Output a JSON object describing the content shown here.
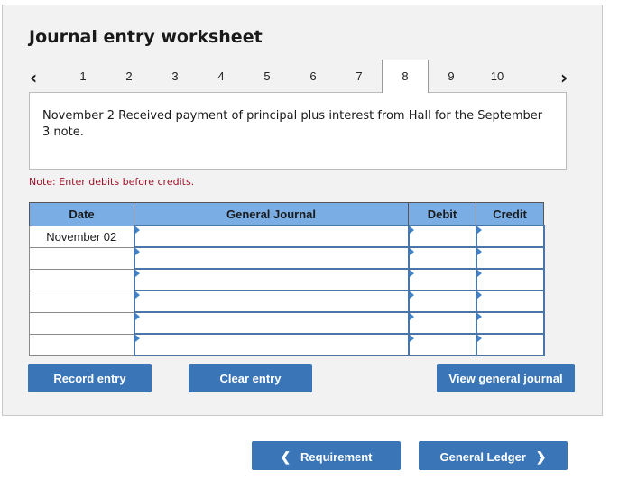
{
  "header": {
    "title": "Journal entry worksheet"
  },
  "tabs": {
    "prev_icon": "‹",
    "next_icon": "›",
    "items": [
      "1",
      "2",
      "3",
      "4",
      "5",
      "6",
      "7",
      "8",
      "9",
      "10"
    ],
    "active": "8"
  },
  "description": "November 2 Received payment of principal plus interest from Hall for the September 3 note.",
  "note": "Note: Enter debits before credits.",
  "journal": {
    "columns": [
      "Date",
      "General Journal",
      "Debit",
      "Credit"
    ],
    "rows": [
      {
        "date": "November 02",
        "account": "",
        "debit": "",
        "credit": ""
      },
      {
        "date": "",
        "account": "",
        "debit": "",
        "credit": ""
      },
      {
        "date": "",
        "account": "",
        "debit": "",
        "credit": ""
      },
      {
        "date": "",
        "account": "",
        "debit": "",
        "credit": ""
      },
      {
        "date": "",
        "account": "",
        "debit": "",
        "credit": ""
      },
      {
        "date": "",
        "account": "",
        "debit": "",
        "credit": ""
      }
    ]
  },
  "buttons": {
    "record": "Record entry",
    "clear": "Clear entry",
    "view_journal": "View general journal",
    "requirement": "Requirement",
    "general_ledger": "General Ledger"
  },
  "colors": {
    "button": "#3a75b8",
    "header": "#7aade3",
    "note": "#a0122a"
  }
}
